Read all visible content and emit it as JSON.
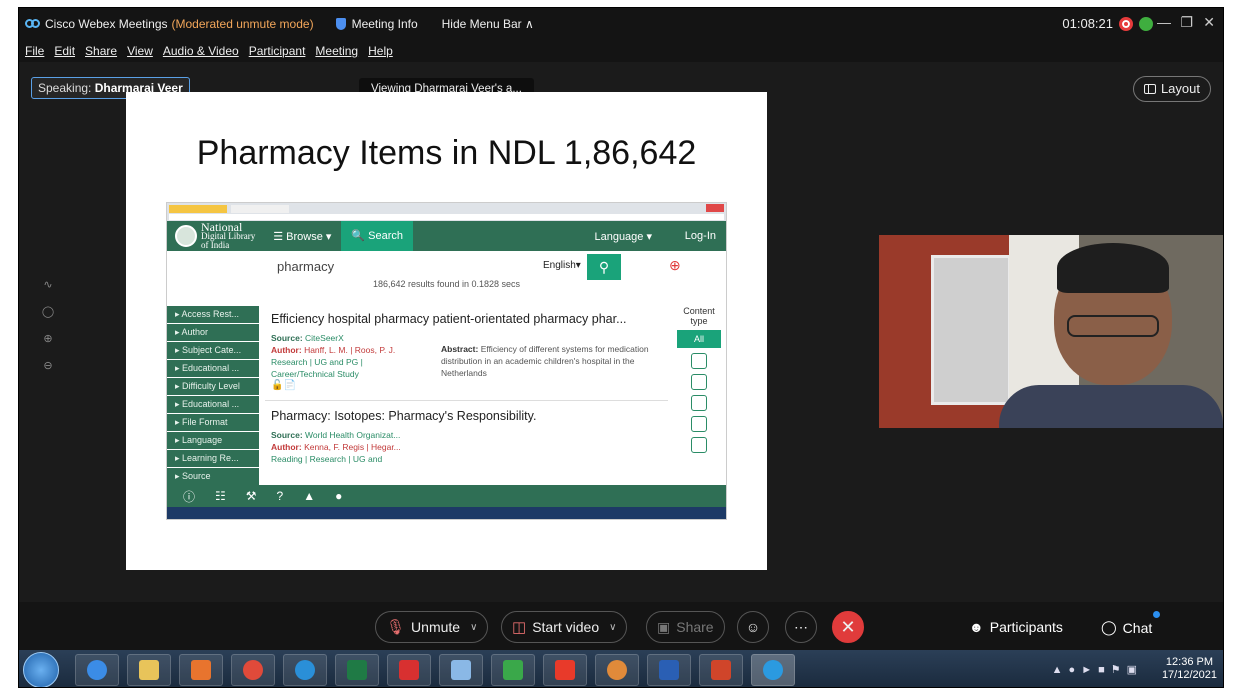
{
  "window": {
    "app_title": "Cisco Webex Meetings",
    "mode": "(Moderated unmute mode)",
    "meeting_info": "Meeting Info",
    "hide_menu": "Hide Menu Bar ∧",
    "timer": "01:08:21"
  },
  "menu": [
    "File",
    "Edit",
    "Share",
    "View",
    "Audio & Video",
    "Participant",
    "Meeting",
    "Help"
  ],
  "stage": {
    "speaking_prefix": "Speaking:",
    "speaking_name": "Dharmaraj Veer",
    "viewing": "Viewing Dharmaraj Veer's a...",
    "layout_label": "Layout"
  },
  "slide": {
    "title": "Pharmacy Items in NDL 1,86,642",
    "ndl": {
      "logo_line1": "National",
      "logo_line2": "Digital Library",
      "logo_line3": "of India",
      "browse": "☰ Browse ▾",
      "search_tab": "🔍 Search",
      "language": "Language ▾",
      "login": "Log-In",
      "query": "pharmacy",
      "query_lang": "English▾",
      "result_count": "186,642 results found in 0.1828 secs",
      "facets": [
        "Access Rest...",
        "Author",
        "Subject Cate...",
        "Educational ...",
        "Difficulty Level",
        "Educational ...",
        "File Format",
        "Language",
        "Learning Re...",
        "Source"
      ],
      "results": [
        {
          "title": "Efficiency hospital pharmacy patient-orientated pharmacy phar...",
          "source_label": "Source:",
          "source": "CiteSeerX",
          "author_label": "Author:",
          "author": "Hanff, L. M. | Roos, P. J.",
          "tags": "Research | UG and PG |",
          "tags2": "Career/Technical Study",
          "abstract_label": "Abstract:",
          "abstract": "Efficiency of different systems for medication distribution in an academic children's hospital in the Netherlands"
        },
        {
          "title": "Pharmacy: Isotopes: Pharmacy's Responsibility.",
          "source_label": "Source:",
          "source": "World Health Organizat...",
          "author_label": "Author:",
          "author": "Kenna, F. Regis | Hegar...",
          "tags": "Reading | Research | UG and"
        }
      ],
      "content_type": "Content type",
      "content_all": "All"
    }
  },
  "toolbar": {
    "unmute": "Unmute",
    "start_video": "Start video",
    "share": "Share",
    "participants": "Participants",
    "chat": "Chat"
  },
  "taskbar": {
    "time": "12:36 PM",
    "date": "17/12/2021",
    "apps": [
      "internet-explorer",
      "file-explorer",
      "media-player",
      "chrome",
      "opera",
      "excel",
      "acrobat",
      "app",
      "marker",
      "anydesk",
      "chrome-profile",
      "word",
      "powerpoint",
      "webex"
    ]
  },
  "colors": {
    "accent_orange": "#f2a65a",
    "ndl_green": "#2f6f55",
    "ndl_teal": "#1aa37a",
    "end_call_red": "#e03b3b"
  }
}
